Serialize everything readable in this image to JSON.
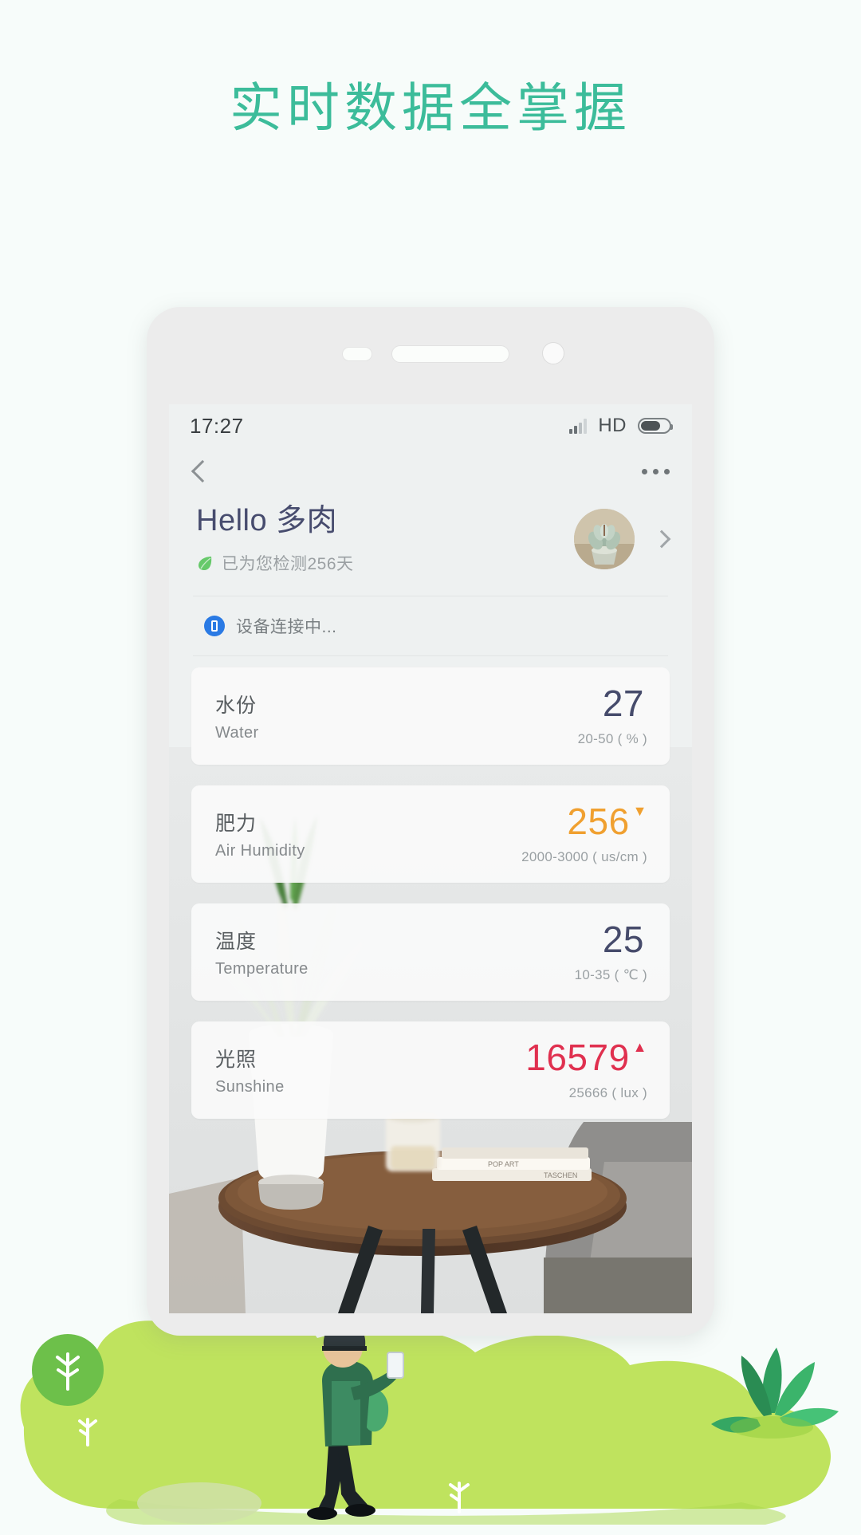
{
  "headline": "实时数据全掌握",
  "theme": {
    "headline_color": "#3cbc9a",
    "grass_color": "#b4e05a",
    "accent_orange": "#f0a030",
    "accent_red": "#e0304f",
    "value_navy": "#464b6b"
  },
  "phone": {
    "statusbar": {
      "time": "17:27",
      "signal_icon": "signal-bars-icon",
      "hd_label": "HD",
      "battery_icon": "battery-icon"
    },
    "navbar": {
      "back_icon": "back-chevron-icon",
      "more_icon": "more-options-icon"
    },
    "profile": {
      "greeting": "Hello 多肉",
      "leaf_icon": "leaf-icon",
      "monitor_days_text": "已为您检测256天",
      "avatar_icon": "succulent-avatar",
      "chevron_icon": "chevron-right-icon"
    },
    "connect": {
      "icon": "device-bluetooth-icon",
      "text": "设备连接中..."
    },
    "cards": [
      {
        "cn": "水份",
        "en": "Water",
        "value": "27",
        "range": "20-50 ( % )",
        "trend": "",
        "color": "#464b6b"
      },
      {
        "cn": "肥力",
        "en": "Air Humidity",
        "value": "256",
        "range": "2000-3000 ( us/cm )",
        "trend": "▼",
        "color": "#f0a030"
      },
      {
        "cn": "温度",
        "en": "Temperature",
        "value": "25",
        "range": "10-35 ( ℃ )",
        "trend": "",
        "color": "#464b6b"
      },
      {
        "cn": "光照",
        "en": "Sunshine",
        "value": "16579",
        "range": "25666 ( lux )",
        "trend": "▲",
        "color": "#e0304f"
      }
    ]
  }
}
